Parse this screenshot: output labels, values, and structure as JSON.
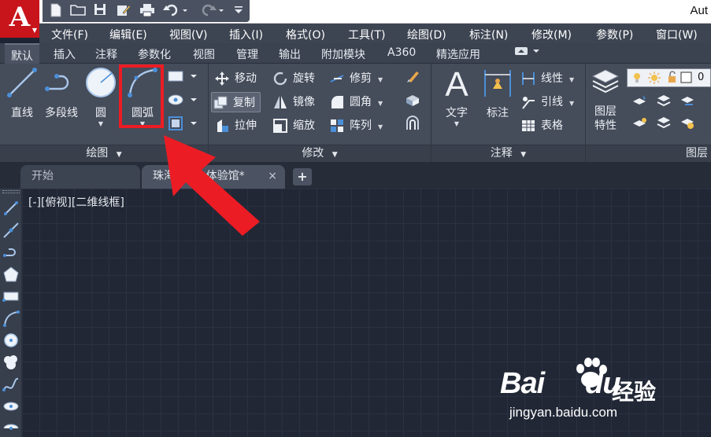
{
  "window": {
    "title_fragment": "Aut"
  },
  "menubar": {
    "items": [
      "文件(F)",
      "编辑(E)",
      "视图(V)",
      "插入(I)",
      "格式(O)",
      "工具(T)",
      "绘图(D)",
      "标注(N)",
      "修改(M)",
      "参数(P)",
      "窗口(W)"
    ]
  },
  "ribbon_tabs": {
    "items": [
      "默认",
      "插入",
      "注释",
      "参数化",
      "视图",
      "管理",
      "输出",
      "附加模块",
      "A360",
      "精选应用"
    ],
    "active": "默认"
  },
  "ribbon": {
    "draw": {
      "title": "绘图",
      "line": "直线",
      "polyline": "多段线",
      "circle": "圆",
      "arc": "圆弧"
    },
    "modify": {
      "title": "修改",
      "move": "移动",
      "rotate": "旋转",
      "trim": "修剪",
      "copy": "复制",
      "mirror": "镜像",
      "fillet": "圆角",
      "stretch": "拉伸",
      "scale": "缩放",
      "array": "阵列"
    },
    "annotation": {
      "title": "注释",
      "text": "文字",
      "dimension": "标注",
      "linear": "线性",
      "leader": "引线",
      "table": "表格"
    },
    "layers": {
      "title_fragment": "图层",
      "properties_line1": "图层",
      "properties_line2": "特性",
      "current_layer": "0"
    }
  },
  "doc_tabs": {
    "start": "开始",
    "drawing": "珠海V",
    "drawing_tail": "体验馆*",
    "close": "×",
    "new": "+"
  },
  "canvas": {
    "viewport_label": "[-][俯视][二维线框]"
  },
  "watermark": {
    "brand": "Bai",
    "brand_suffix": "du",
    "brand_cn": "经验",
    "url": "jingyan.baidu.com"
  },
  "colors": {
    "accent_red": "#ec1c24",
    "ribbon_bg": "#454c5a",
    "canvas_bg": "#212735",
    "logo_red": "#c8141b"
  }
}
